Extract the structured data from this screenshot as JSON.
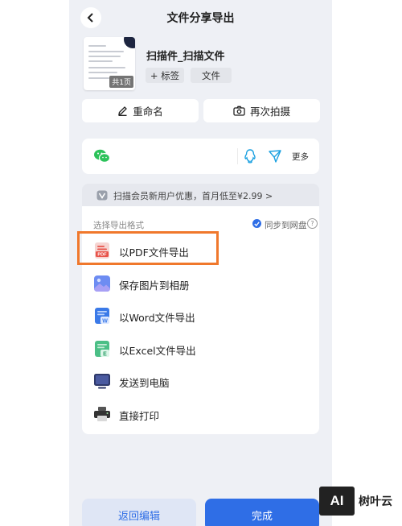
{
  "header": {
    "title": "文件分享导出"
  },
  "document": {
    "name": "扫描件_扫描文件",
    "pages_badge": "共1页",
    "tag_chip": "+ 标签",
    "type_chip": "文件"
  },
  "actions": {
    "rename": "重命名",
    "rescan": "再次拍摄"
  },
  "share": {
    "more": "更多"
  },
  "promo": {
    "text": "扫描会员新用户优惠，首月低至¥2.99 >"
  },
  "export": {
    "section_label": "选择导出格式",
    "sync_label": "同步到网盘",
    "help": "?",
    "options": [
      {
        "label": "以PDF文件导出",
        "icon_text": "PDF"
      },
      {
        "label": "保存图片到相册"
      },
      {
        "label": "以Word文件导出",
        "icon_text": "W"
      },
      {
        "label": "以Excel文件导出",
        "icon_text": "E"
      },
      {
        "label": "发送到电脑"
      },
      {
        "label": "直接打印"
      }
    ]
  },
  "bottom": {
    "back_edit": "返回编辑",
    "done": "完成"
  },
  "watermark": {
    "logo": "AI",
    "text": "树叶云"
  },
  "colors": {
    "primary": "#2f6ee6",
    "highlight": "#f0782c",
    "pdf": "#e8534a",
    "word": "#3b7ae8",
    "excel": "#4bbf86",
    "wechat": "#2cc25a"
  }
}
